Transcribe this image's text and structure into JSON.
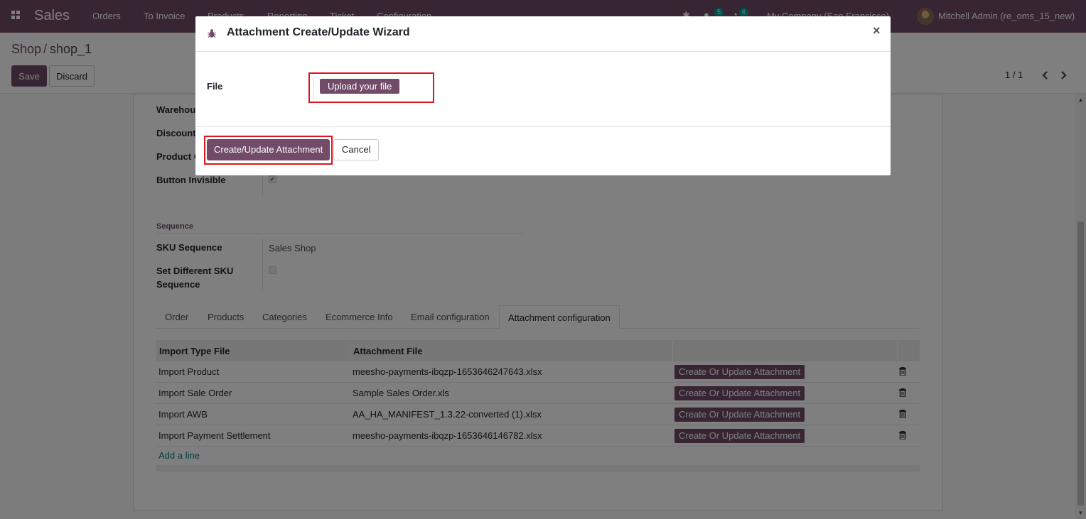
{
  "navbar": {
    "app_name": "Sales",
    "menu": [
      "Orders",
      "To Invoice",
      "Products",
      "Reporting",
      "Ticket",
      "Configuration"
    ],
    "chat_count": "5",
    "activity_count": "6",
    "company": "My Company (San Francisco)",
    "user": "Mitchell Admin (re_oms_15_new)"
  },
  "breadcrumb": {
    "parent": "Shop",
    "separator": "/",
    "current": "shop_1"
  },
  "buttons": {
    "save": "Save",
    "discard": "Discard"
  },
  "pager": {
    "value": "1 / 1"
  },
  "form": {
    "fields": {
      "warehouse": "Warehou",
      "discount": "Discount",
      "product": "Product C",
      "button_invisible": "Button Invisible",
      "button_invisible_checked": true
    },
    "sequence_section": "Sequence",
    "sku_sequence_label": "SKU Sequence",
    "sku_sequence_value": "Sales Shop",
    "set_diff_sku_label_1": "Set Different SKU",
    "set_diff_sku_label_2": "Sequence",
    "set_diff_sku_checked": false
  },
  "tabs": [
    "Order",
    "Products",
    "Categories",
    "Ecommerce Info",
    "Email configuration",
    "Attachment configuration"
  ],
  "active_tab": "Attachment configuration",
  "attachment_table": {
    "columns": [
      "Import Type File",
      "Attachment File"
    ],
    "rows": [
      {
        "type": "Import Product",
        "file": "meesho-payments-ibqzp-1653646247643.xlsx",
        "action": "Create Or Update Attachment"
      },
      {
        "type": "Import Sale Order",
        "file": "Sample Sales Order.xls",
        "action": "Create Or Update Attachment"
      },
      {
        "type": "Import AWB",
        "file": "AA_HA_MANIFEST_1.3.22-converted (1).xlsx",
        "action": "Create Or Update Attachment"
      },
      {
        "type": "Import Payment Settlement",
        "file": "meesho-payments-ibqzp-1653646146782.xlsx",
        "action": "Create Or Update Attachment"
      }
    ],
    "add_line": "Add a line"
  },
  "modal": {
    "title": "Attachment Create/Update Wizard",
    "close": "×",
    "file_label": "File",
    "upload_button": "Upload your file",
    "primary_button": "Create/Update Attachment",
    "cancel_button": "Cancel"
  },
  "colors": {
    "brand": "#714b67",
    "highlight": "#e0141e",
    "link": "#017e84"
  }
}
